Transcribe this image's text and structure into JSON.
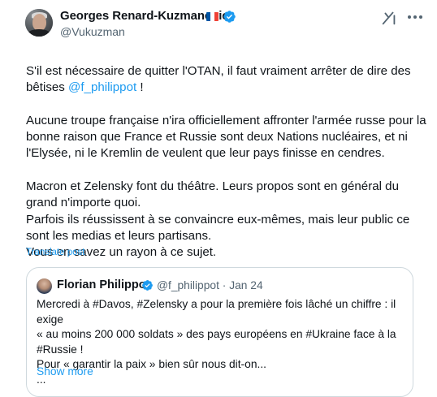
{
  "tweet": {
    "author": {
      "name": "Georges Renard-Kuzmanovic",
      "handle": "@Vukuzman",
      "flag_colors": [
        "#0055a4",
        "#ffffff",
        "#ef4135"
      ],
      "verified_color": "#1d9bf0"
    },
    "paragraphs": [
      {
        "before": "S'il est nécessaire de quitter l'OTAN, il faut vraiment arrêter de dire des bêtises ",
        "mention": "@f_philippot",
        "after": " !"
      },
      {
        "text": "Aucune troupe française n'ira officiellement affronter l'armée russe pour la bonne raison que France et Russie sont deux Nations nucléaires, et ni l'Elysée, ni le Kremlin de veulent que leur pays finisse en cendres."
      },
      {
        "text": "Macron et Zelensky font du théâtre. Leurs propos sont en général du grand n'importe quoi."
      },
      {
        "text": "Parfois ils réussissent à se convaincre eux-mêmes,  mais leur public ce sont les medias et leurs partisans."
      },
      {
        "text": "Vous en savez un rayon à ce sujet."
      }
    ],
    "translate_label": "Translate post",
    "icons": [
      "grok-icon",
      "more-icon",
      "verified-icon"
    ]
  },
  "quote": {
    "name": "Florian Philippot",
    "handle": "@f_philippot",
    "separator": "·",
    "date": "Jan 24",
    "lines": [
      "Mercredi à #Davos, #Zelensky a pour la première fois lâché un chiffre : il exige",
      "« au moins 200 000 soldats » des pays européens en #Ukraine face à la",
      "#Russie  !",
      "Pour « garantir la paix » bien sûr nous dit-on...",
      "..."
    ],
    "show_more_label": "Show more"
  }
}
